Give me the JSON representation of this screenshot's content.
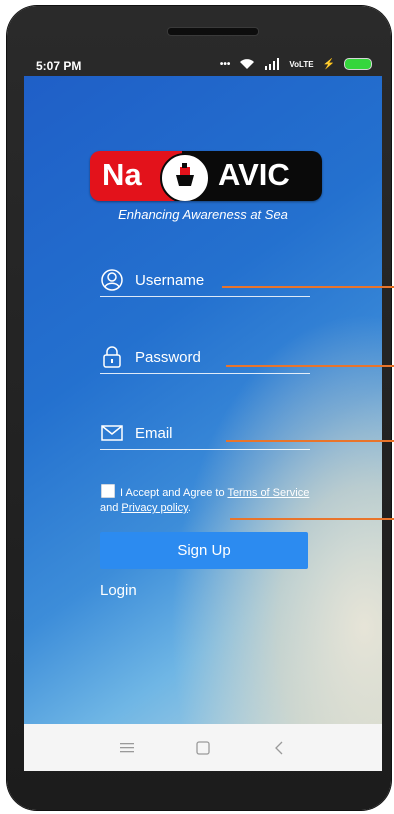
{
  "status_bar": {
    "time": "5:07 PM",
    "icons": [
      "more-dots-icon",
      "wifi-icon",
      "signal-icon",
      "volte-icon",
      "charging-icon",
      "battery-icon"
    ],
    "volte_text": "VoLTE"
  },
  "app": {
    "logo_left": "Na",
    "logo_right": "AVIC",
    "tagline": "Enhancing Awareness at Sea"
  },
  "form": {
    "username_placeholder": "Username",
    "password_placeholder": "Password",
    "email_placeholder": "Email",
    "agree_prefix": "I Accept and Agree to ",
    "terms_link": "Terms of Service",
    "agree_and": " and ",
    "privacy_link": "Privacy policy",
    "agree_suffix": ".",
    "checkbox_checked": false
  },
  "buttons": {
    "signup": "Sign Up",
    "login": "Login"
  },
  "colors": {
    "button": "#2c8bf0",
    "annotation": "#e9742b",
    "logo_red": "#e3121b",
    "logo_black": "#0a0a0a"
  }
}
